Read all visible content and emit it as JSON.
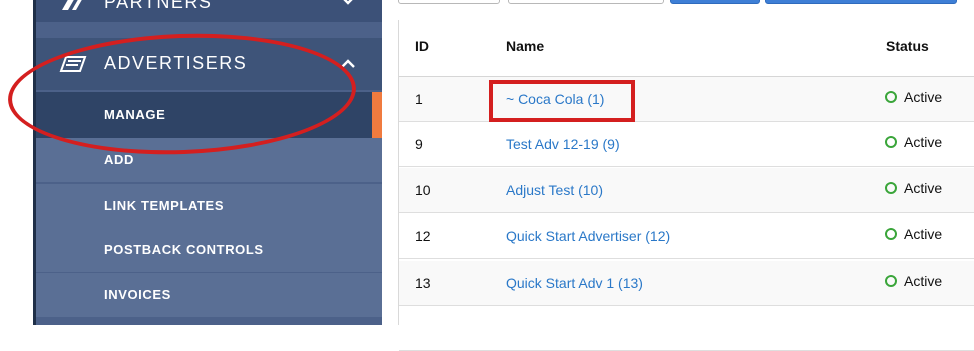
{
  "sidebar": {
    "partners_label": "PARTNERS",
    "advertisers_label": "ADVERTISERS",
    "sub_items": [
      {
        "label": "MANAGE"
      },
      {
        "label": "ADD"
      },
      {
        "label": "LINK TEMPLATES"
      },
      {
        "label": "POSTBACK CONTROLS"
      },
      {
        "label": "INVOICES"
      }
    ]
  },
  "table": {
    "columns": [
      "ID",
      "Name",
      "Status"
    ],
    "rows": [
      {
        "id": "1",
        "name": "~ Coca Cola (1)",
        "status": "Active"
      },
      {
        "id": "9",
        "name": "Test Adv 12-19 (9)",
        "status": "Active"
      },
      {
        "id": "10",
        "name": "Adjust Test (10)",
        "status": "Active"
      },
      {
        "id": "12",
        "name": "Quick Start Advertiser (12)",
        "status": "Active"
      },
      {
        "id": "13",
        "name": "Quick Start Adv 1 (13)",
        "status": "Active"
      }
    ]
  },
  "colors": {
    "sidebar_bg": "#4c6189",
    "active_indicator": "#f07b3f",
    "link": "#2a78c8",
    "status_active": "#3aa53a",
    "annotation": "#d41f1f"
  },
  "icons": {
    "partners": "partners-icon",
    "advertisers": "advertisers-icon",
    "collapse": "chevron-up-icon",
    "expand": "chevron-down-icon",
    "status": "status-circle-icon"
  }
}
